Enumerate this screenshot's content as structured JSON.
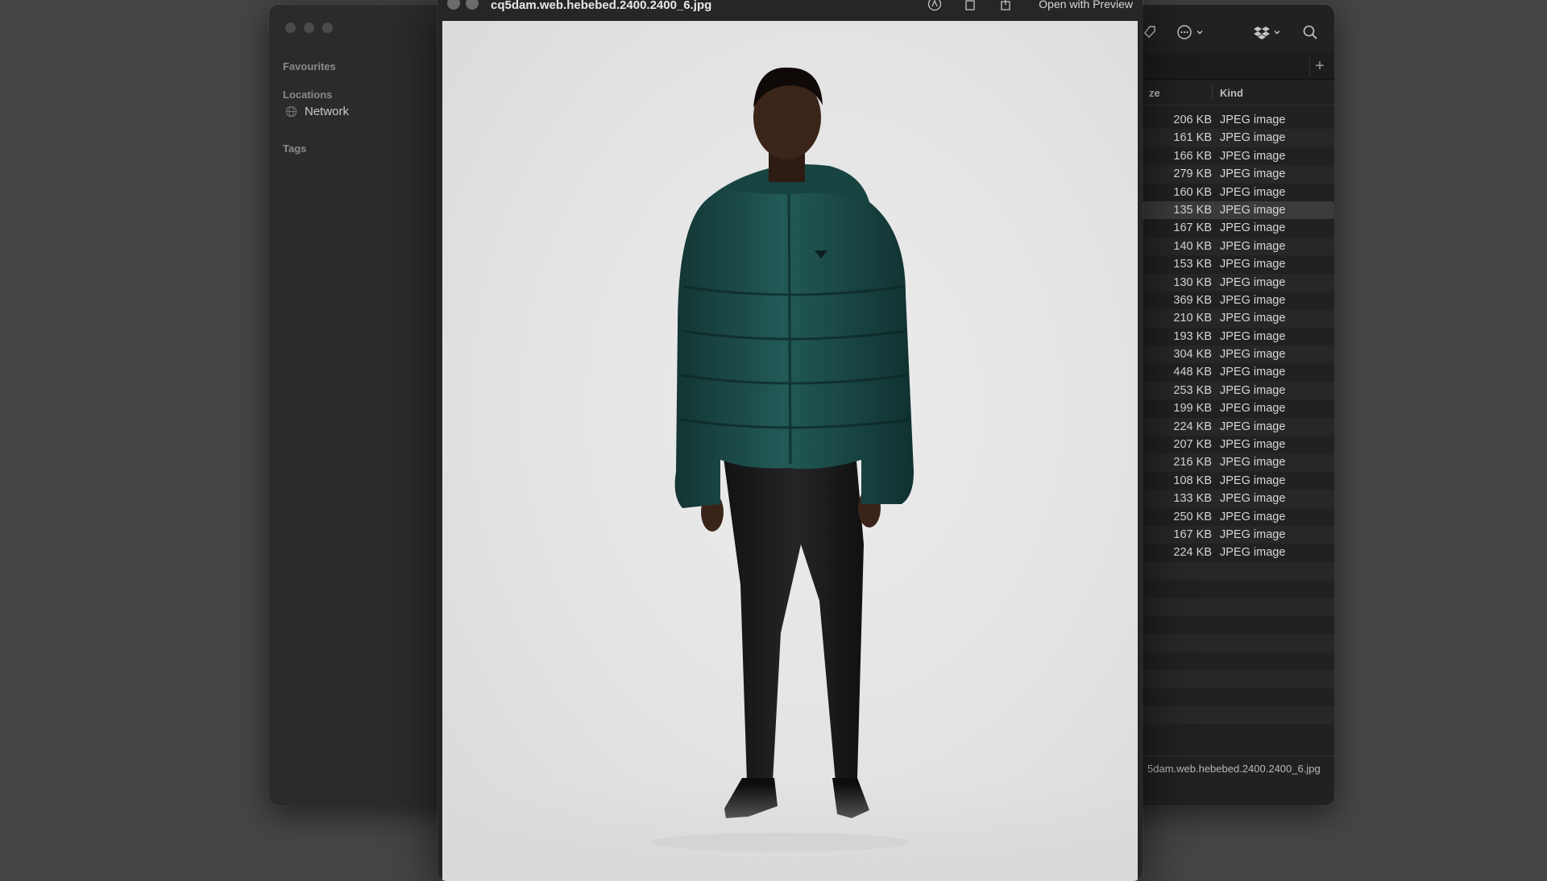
{
  "sidebar": {
    "favourites": "Favourites",
    "locations": "Locations",
    "network": "Network",
    "tags": "Tags"
  },
  "columns": {
    "size": "ze",
    "kind": "Kind"
  },
  "rows": [
    {
      "size": "206 KB",
      "kind": "JPEG image"
    },
    {
      "size": "161 KB",
      "kind": "JPEG image"
    },
    {
      "size": "166 KB",
      "kind": "JPEG image"
    },
    {
      "size": "279 KB",
      "kind": "JPEG image"
    },
    {
      "size": "160 KB",
      "kind": "JPEG image"
    },
    {
      "size": "135 KB",
      "kind": "JPEG image"
    },
    {
      "size": "167 KB",
      "kind": "JPEG image"
    },
    {
      "size": "140 KB",
      "kind": "JPEG image"
    },
    {
      "size": "153 KB",
      "kind": "JPEG image"
    },
    {
      "size": "130 KB",
      "kind": "JPEG image"
    },
    {
      "size": "369 KB",
      "kind": "JPEG image"
    },
    {
      "size": "210 KB",
      "kind": "JPEG image"
    },
    {
      "size": "193 KB",
      "kind": "JPEG image"
    },
    {
      "size": "304 KB",
      "kind": "JPEG image"
    },
    {
      "size": "448 KB",
      "kind": "JPEG image"
    },
    {
      "size": "253 KB",
      "kind": "JPEG image"
    },
    {
      "size": "199 KB",
      "kind": "JPEG image"
    },
    {
      "size": "224 KB",
      "kind": "JPEG image"
    },
    {
      "size": "207 KB",
      "kind": "JPEG image"
    },
    {
      "size": "216 KB",
      "kind": "JPEG image"
    },
    {
      "size": "108 KB",
      "kind": "JPEG image"
    },
    {
      "size": "133 KB",
      "kind": "JPEG image"
    },
    {
      "size": "250 KB",
      "kind": "JPEG image"
    },
    {
      "size": "167 KB",
      "kind": "JPEG image"
    },
    {
      "size": "224 KB",
      "kind": "JPEG image"
    }
  ],
  "pathbar": "5dam.web.hebebed.2400.2400_6.jpg",
  "quicklook": {
    "title": "cq5dam.web.hebebed.2400.2400_6.jpg",
    "open_with": "Open with Preview"
  },
  "colors": {
    "jacket": "#1d4a48",
    "pants": "#1a1a1b",
    "background": "#e3e3e3"
  }
}
